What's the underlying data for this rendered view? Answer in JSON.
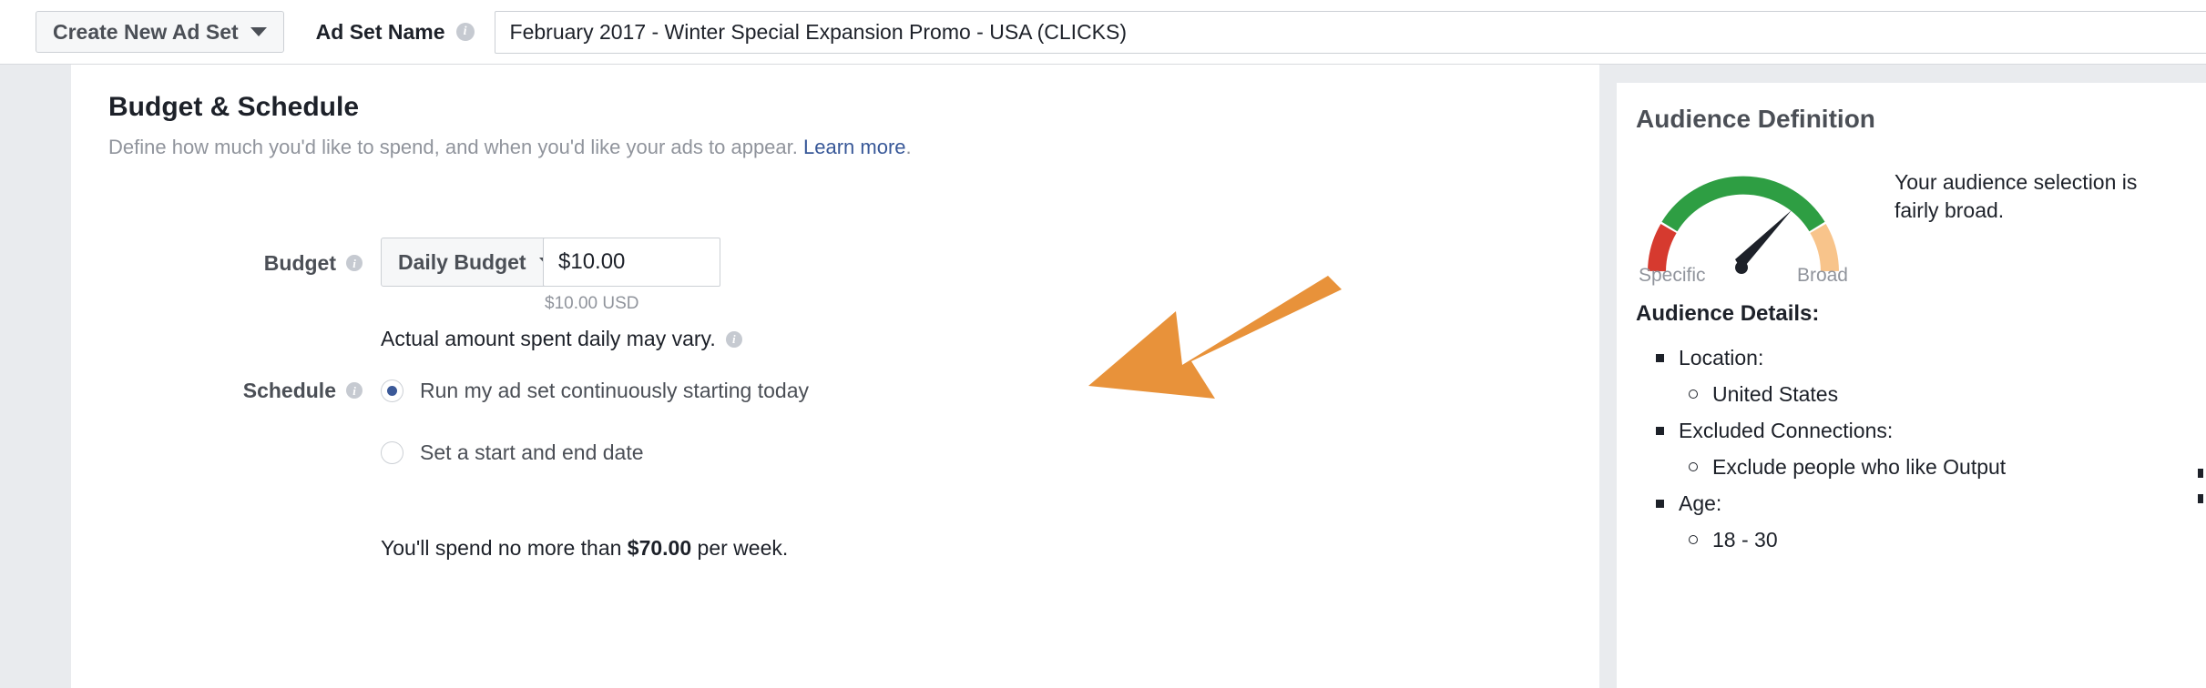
{
  "topbar": {
    "create_button_label": "Create New Ad Set",
    "caret_icon": "chevron-down-icon",
    "adset_name_label": "Ad Set Name",
    "info_icon": "info-icon",
    "adset_name_value": "February 2017 - Winter Special Expansion Promo - USA (CLICKS)",
    "adset_name_placeholder": "Ad Set Name"
  },
  "main": {
    "section_title": "Budget & Schedule",
    "section_sub_text": "Define how much you'd like to spend, and when you'd like your ads to appear. ",
    "section_sub_link": "Learn more",
    "section_sub_end": ".",
    "budget_label": "Budget",
    "budget_type_value": "Daily Budget",
    "budget_amount_value": "$10.00",
    "budget_amount_placeholder": "$0.00",
    "budget_helper": "$10.00 USD",
    "actual_amount_note": "Actual amount spent daily may vary.",
    "schedule_label": "Schedule",
    "schedule_options": [
      {
        "label": "Run my ad set continuously starting today",
        "selected": true
      },
      {
        "label": "Set a start and end date",
        "selected": false
      }
    ],
    "spend_prefix": "You'll spend no more than ",
    "spend_amount": "$70.00",
    "spend_suffix": " per week."
  },
  "annotation": {
    "arrow_icon": "arrow-pointing-down-left-icon",
    "arrow_color": "#E8923A",
    "points_at": "budget-amount-input"
  },
  "audience": {
    "title": "Audience Definition",
    "gauge": {
      "icon": "audience-gauge-icon",
      "scale_left_label": "Specific",
      "scale_right_label": "Broad",
      "needle_position": "fairly-broad",
      "colors": {
        "specific": "#D63A2F",
        "middle": "#2E9E43",
        "broad": "#F8C48B"
      }
    },
    "verdict": "Your audience selection is fairly broad.",
    "details_title": "Audience Details:",
    "details": [
      {
        "label": "Location:",
        "values": [
          "United States"
        ]
      },
      {
        "label": "Excluded Connections:",
        "values": [
          "Exclude people who like Output"
        ]
      },
      {
        "label": "Age:",
        "values": [
          "18 - 30"
        ]
      }
    ]
  }
}
